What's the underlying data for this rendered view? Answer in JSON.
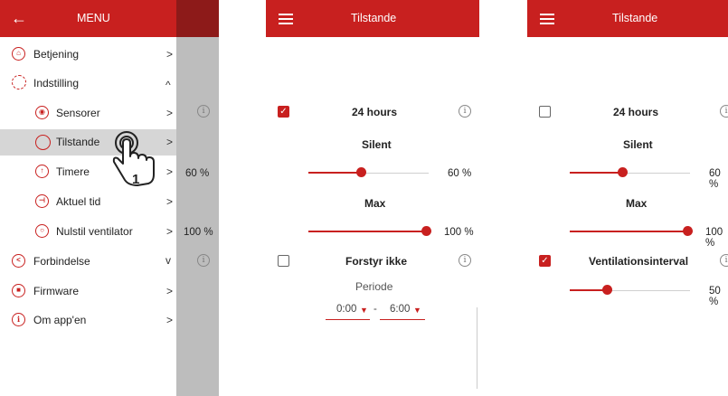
{
  "panel1": {
    "header_title": "MENU",
    "items": [
      {
        "label": "Betjening",
        "chev": ">"
      },
      {
        "label": "Indstilling",
        "chev": "^"
      },
      {
        "label": "Sensorer",
        "chev": ">"
      },
      {
        "label": "Tilstande",
        "chev": ">"
      },
      {
        "label": "Timere",
        "chev": ">"
      },
      {
        "label": "Aktuel tid",
        "chev": ">"
      },
      {
        "label": "Nulstil ventilator",
        "chev": ">"
      },
      {
        "label": "Forbindelse",
        "chev": "v"
      },
      {
        "label": "Firmware",
        "chev": ">"
      },
      {
        "label": "Om app'en",
        "chev": ">"
      }
    ],
    "behind": {
      "value_60": "60 %",
      "value_100": "100 %"
    },
    "touch_number": "1"
  },
  "panel2": {
    "header_title": "Tilstande",
    "mode1": {
      "label": "24 hours",
      "checked": true
    },
    "silent": {
      "label": "Silent",
      "value": "60 %",
      "level": 0.6
    },
    "max": {
      "label": "Max",
      "value": "100 %",
      "level": 1.0
    },
    "mode2": {
      "label": "Forstyr ikke",
      "checked": false
    },
    "periode": {
      "label": "Periode",
      "from": "0:00",
      "separator": "-",
      "to": "6:00"
    }
  },
  "panel3": {
    "header_title": "Tilstande",
    "mode1": {
      "label": "24 hours",
      "checked": false
    },
    "silent": {
      "label": "Silent",
      "value": "60 %",
      "level": 0.6
    },
    "max": {
      "label": "Max",
      "value": "100 %",
      "level": 1.0
    },
    "mode2": {
      "label": "Ventilationsinterval",
      "checked": true,
      "value": "50 %",
      "level": 0.5
    }
  },
  "colors": {
    "accent": "#c8201f",
    "overlay": "#bdbdbd",
    "highlight": "#d6d6d6"
  }
}
